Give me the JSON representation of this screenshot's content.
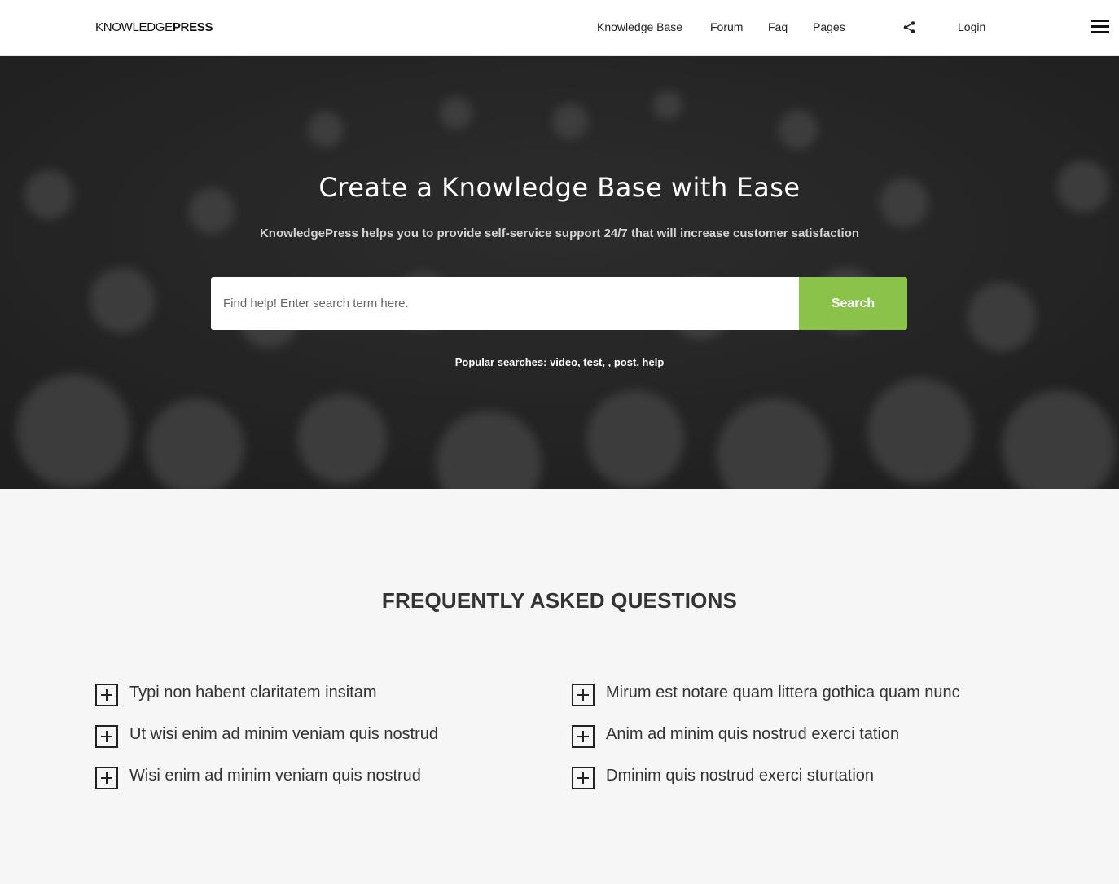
{
  "header": {
    "logo_light": "KNOWLEDGE",
    "logo_bold": "PRESS",
    "nav": [
      "Knowledge Base",
      "Forum",
      "Faq",
      "Pages"
    ],
    "share_icon": "share-icon",
    "login": "Login",
    "menu_icon": "hamburger-menu-icon"
  },
  "hero": {
    "title": "Create a Knowledge Base with Ease",
    "subtitle": "KnowledgePress helps you to provide self-service support 24/7 that will increase customer satisfaction",
    "search": {
      "placeholder": "Find help! Enter search term here.",
      "value": "",
      "button": "Search"
    },
    "popular_label": "Popular searches:",
    "popular_terms": [
      "video",
      "test",
      "",
      "post",
      "help"
    ],
    "colors": {
      "accent": "#8bc34a"
    }
  },
  "faq": {
    "title": "FREQUENTLY ASKED QUESTIONS",
    "left": [
      "Typi non habent claritatem insitam",
      "Ut wisi enim ad minim veniam quis nostrud",
      "Wisi enim ad minim veniam quis nostrud"
    ],
    "right": [
      "Mirum est notare quam littera gothica quam nunc",
      "Anim ad minim quis nostrud exerci tation",
      "Dminim quis nostrud exerci sturtation"
    ]
  }
}
